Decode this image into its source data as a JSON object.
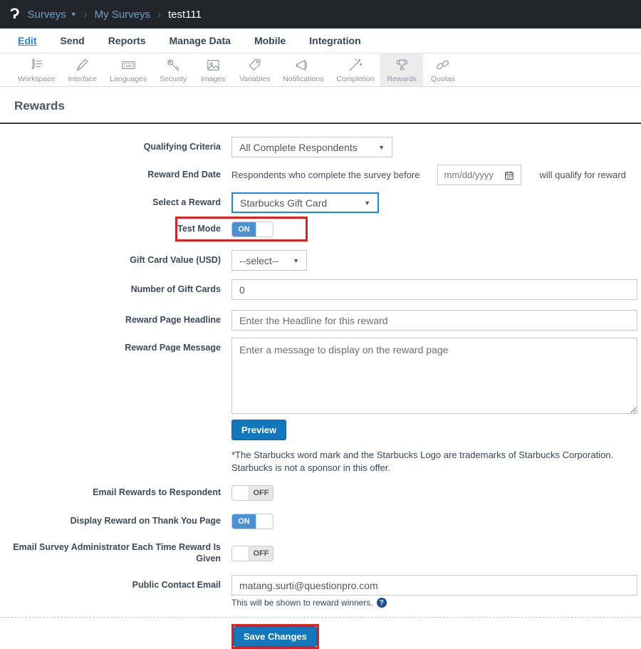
{
  "header": {
    "logo": "Ɂ",
    "breadcrumb": {
      "root": "Surveys",
      "section": "My Surveys",
      "current": "test111",
      "separator": "›"
    }
  },
  "menu": {
    "items": [
      "Edit",
      "Send",
      "Reports",
      "Manage Data",
      "Mobile",
      "Integration"
    ],
    "active": "Edit"
  },
  "toolbar": {
    "items": [
      {
        "label": "Workspace"
      },
      {
        "label": "Interface"
      },
      {
        "label": "Languages"
      },
      {
        "label": "Security"
      },
      {
        "label": "Images"
      },
      {
        "label": "Variables"
      },
      {
        "label": "Notifications"
      },
      {
        "label": "Completion"
      },
      {
        "label": "Rewards"
      },
      {
        "label": "Quotas"
      }
    ],
    "active": "Rewards"
  },
  "page": {
    "title": "Rewards"
  },
  "form": {
    "qualifying_criteria": {
      "label": "Qualifying Criteria",
      "value": "All Complete Respondents"
    },
    "reward_end_date": {
      "label": "Reward End Date",
      "prefix": "Respondents who complete the survey before",
      "placeholder": "mm/dd/yyyy",
      "suffix": "will qualify for reward"
    },
    "select_reward": {
      "label": "Select a Reward",
      "value": "Starbucks Gift Card"
    },
    "test_mode": {
      "label": "Test Mode",
      "state": "ON"
    },
    "gift_card_value": {
      "label": "Gift Card Value (USD)",
      "value": "--select--"
    },
    "number_of_gift_cards": {
      "label": "Number of Gift Cards",
      "value": "0"
    },
    "reward_page_headline": {
      "label": "Reward Page Headline",
      "placeholder": "Enter the Headline for this reward"
    },
    "reward_page_message": {
      "label": "Reward Page Message",
      "placeholder": "Enter a message to display on the reward page"
    },
    "preview_button": "Preview",
    "disclaimer": "*The Starbucks word mark and the Starbucks Logo are trademarks of Starbucks Corporation. Starbucks is not a sponsor in this offer.",
    "email_rewards": {
      "label": "Email Rewards to Respondent",
      "state": "OFF"
    },
    "display_reward": {
      "label": "Display Reward on Thank You Page",
      "state": "ON"
    },
    "email_admin": {
      "label": "Email Survey Administrator Each Time Reward Is Given",
      "state": "OFF"
    },
    "public_contact_email": {
      "label": "Public Contact Email",
      "value": "matang.surti@questionpro.com",
      "helper": "This will be shown to reward winners.",
      "help_icon": "?"
    },
    "save_button": "Save Changes"
  },
  "colors": {
    "header_bg": "#22262b",
    "link_blue": "#1b87e6",
    "button_blue": "#1377bd",
    "toggle_on_blue": "#4a90d2",
    "annotation_red": "#e01f1f"
  }
}
